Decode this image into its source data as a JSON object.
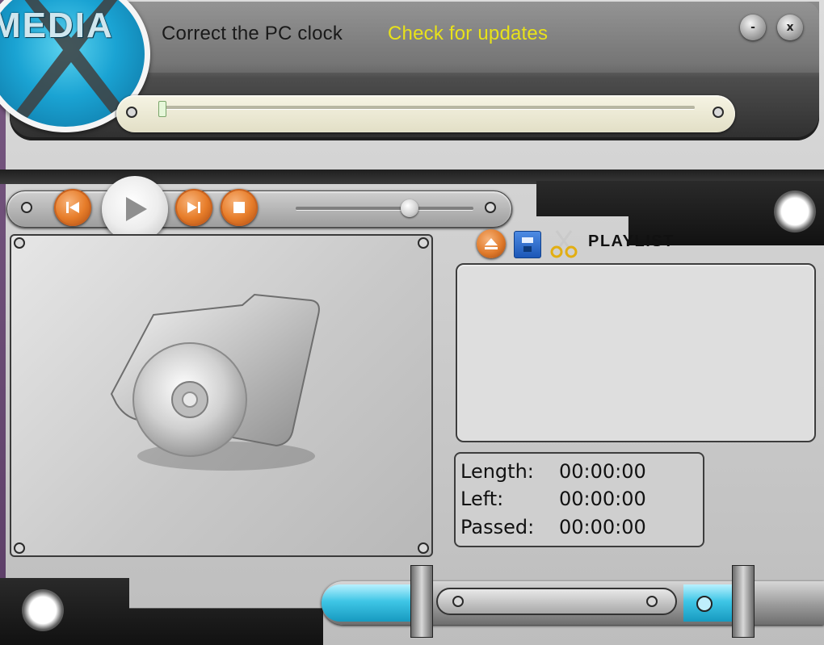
{
  "app": {
    "logo_text": "MEDIA"
  },
  "menu": {
    "correct_clock": "Correct the PC clock",
    "check_updates": "Check for updates"
  },
  "window_buttons": {
    "minimize": "-",
    "close": "x"
  },
  "transport": {
    "prev_icon": "skip-back-icon",
    "play_icon": "play-icon",
    "next_icon": "skip-forward-icon",
    "stop_icon": "stop-icon",
    "volume_level": 0.64,
    "seek_position": 0.0
  },
  "playlist": {
    "title": "PLAYLIST",
    "items": [],
    "icons": [
      "eject-icon",
      "save-icon",
      "scissors-icon"
    ]
  },
  "time_info": {
    "length_label": "Length:",
    "length_value": "00:00:00",
    "left_label": "Left:",
    "left_value": "00:00:00",
    "passed_label": "Passed:",
    "passed_value": "00:00:00"
  },
  "colors": {
    "accent_orange": "#e77d2a",
    "accent_cyan": "#3fc6e6",
    "link_yellow": "#e8e21a"
  }
}
